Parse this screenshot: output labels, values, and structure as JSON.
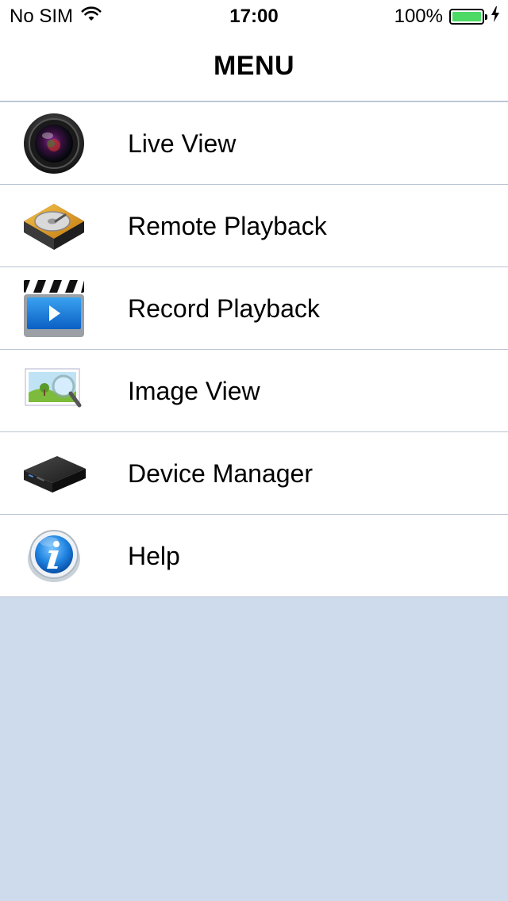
{
  "status_bar": {
    "carrier": "No SIM",
    "time": "17:00",
    "battery_percent": "100%",
    "battery_level": 1.0,
    "icons": [
      "wifi-icon",
      "battery-icon",
      "charging-bolt-icon"
    ]
  },
  "nav": {
    "title": "MENU"
  },
  "menu": {
    "items": [
      {
        "label": "Live View",
        "icon": "camera-lens-icon"
      },
      {
        "label": "Remote Playback",
        "icon": "hard-drive-icon"
      },
      {
        "label": "Record Playback",
        "icon": "clapperboard-icon"
      },
      {
        "label": "Image View",
        "icon": "image-magnifier-icon"
      },
      {
        "label": "Device Manager",
        "icon": "dvr-device-icon"
      },
      {
        "label": "Help",
        "icon": "info-icon"
      }
    ]
  },
  "colors": {
    "background": "#cddbec",
    "list_background": "#ffffff",
    "separator": "#b9c3d1",
    "battery": "#4cd964"
  }
}
